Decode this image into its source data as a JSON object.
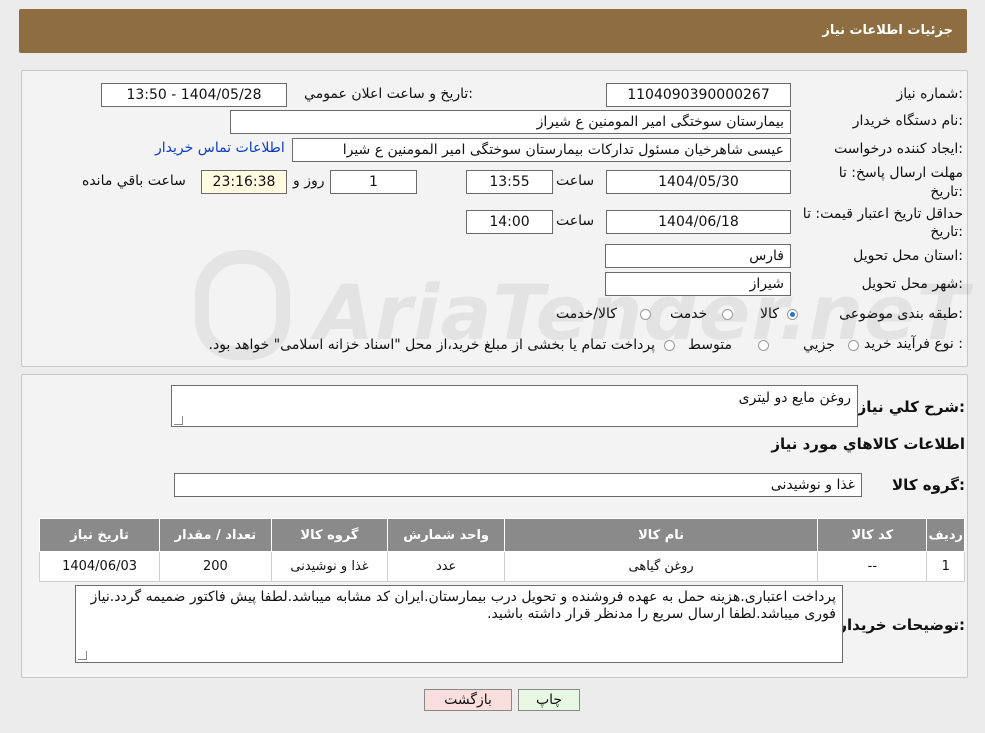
{
  "header": {
    "title": "جزئیات اطلاعات نیاز"
  },
  "form": {
    "need_number_label": "شماره نیاز:",
    "need_number": "1104090390000267",
    "announce_label": "تاریخ و ساعت اعلان عمومي:",
    "announce_value": "1404/05/28 - 13:50",
    "buyer_org_label": "نام دستگاه خريدار:",
    "buyer_org": "بیمارستان سوختگی امیر المومنین  ع  شیراز",
    "creator_label": "ايجاد كننده درخواست:",
    "creator": "عیسی  شاهرخیان مسئول تدارکات بیمارستان سوختگی امیر المومنین  ع  شیرا",
    "contact_link": "اطلاعات تماس خريدار",
    "deadline_label": "مهلت ارسال پاسخ: تا",
    "deadline_label2": "تاريخ:",
    "deadline_date": "1404/05/30",
    "time_label": "ساعت",
    "deadline_time": "13:55",
    "days_value": "1",
    "days_label": "روز و",
    "remaining_time": "23:16:38",
    "remaining_label": "ساعت باقي مانده",
    "validity_label": "حداقل تاريخ اعتبار قيمت: تا",
    "validity_label2": "تاريخ:",
    "validity_date": "1404/06/18",
    "validity_time": "14:00",
    "province_label": "استان محل تحويل:",
    "province": "فارس",
    "city_label": "شهر محل تحويل:",
    "city": "شیراز",
    "category_label": "طبقه بندی موضوعی:",
    "category_options": [
      "کالا",
      "خدمت",
      "کالا/خدمت"
    ],
    "process_label": "نوع فرآيند خريد :",
    "process_options": [
      "جزيي",
      "متوسط"
    ],
    "process_note": "پرداخت تمام یا بخشی از مبلغ خرید،از محل \"اسناد خزانه اسلامی\" خواهد بود."
  },
  "summary": {
    "description_label": "شرح كلي نياز:",
    "description": "روغن مایع دو لیتری",
    "goods_info_title": "اطلاعات كالاهاي مورد نياز",
    "goods_group_label": "گروه كالا:",
    "goods_group": "غذا و نوشیدنی",
    "table": {
      "headers": [
        "رديف",
        "كد كالا",
        "نام كالا",
        "واحد شمارش",
        "گروه كالا",
        "تعداد / مقدار",
        "تاريخ نياز"
      ],
      "rows": [
        [
          "1",
          "--",
          "روغن گیاهی",
          "عدد",
          "غذا و نوشیدنی",
          "200",
          "1404/06/03"
        ]
      ]
    },
    "buyer_notes_label": "توضيحات خريدار:",
    "buyer_notes": "پرداخت اعتباری.هزینه حمل به عهده فروشنده و تحویل درب بیمارستان.ایران کد مشابه میباشد.لطفا پیش فاکتور ضمیمه گردد.نیاز فوری میباشد.لطفا ارسال سریع را مدنظر قرار داشته باشید."
  },
  "buttons": {
    "print": "چاپ",
    "back": "بازگشت"
  },
  "colors": {
    "header": "#8e6d41",
    "link": "#0b3cc5",
    "back_button": "#f9dede",
    "print_button": "#e8f7e3"
  }
}
